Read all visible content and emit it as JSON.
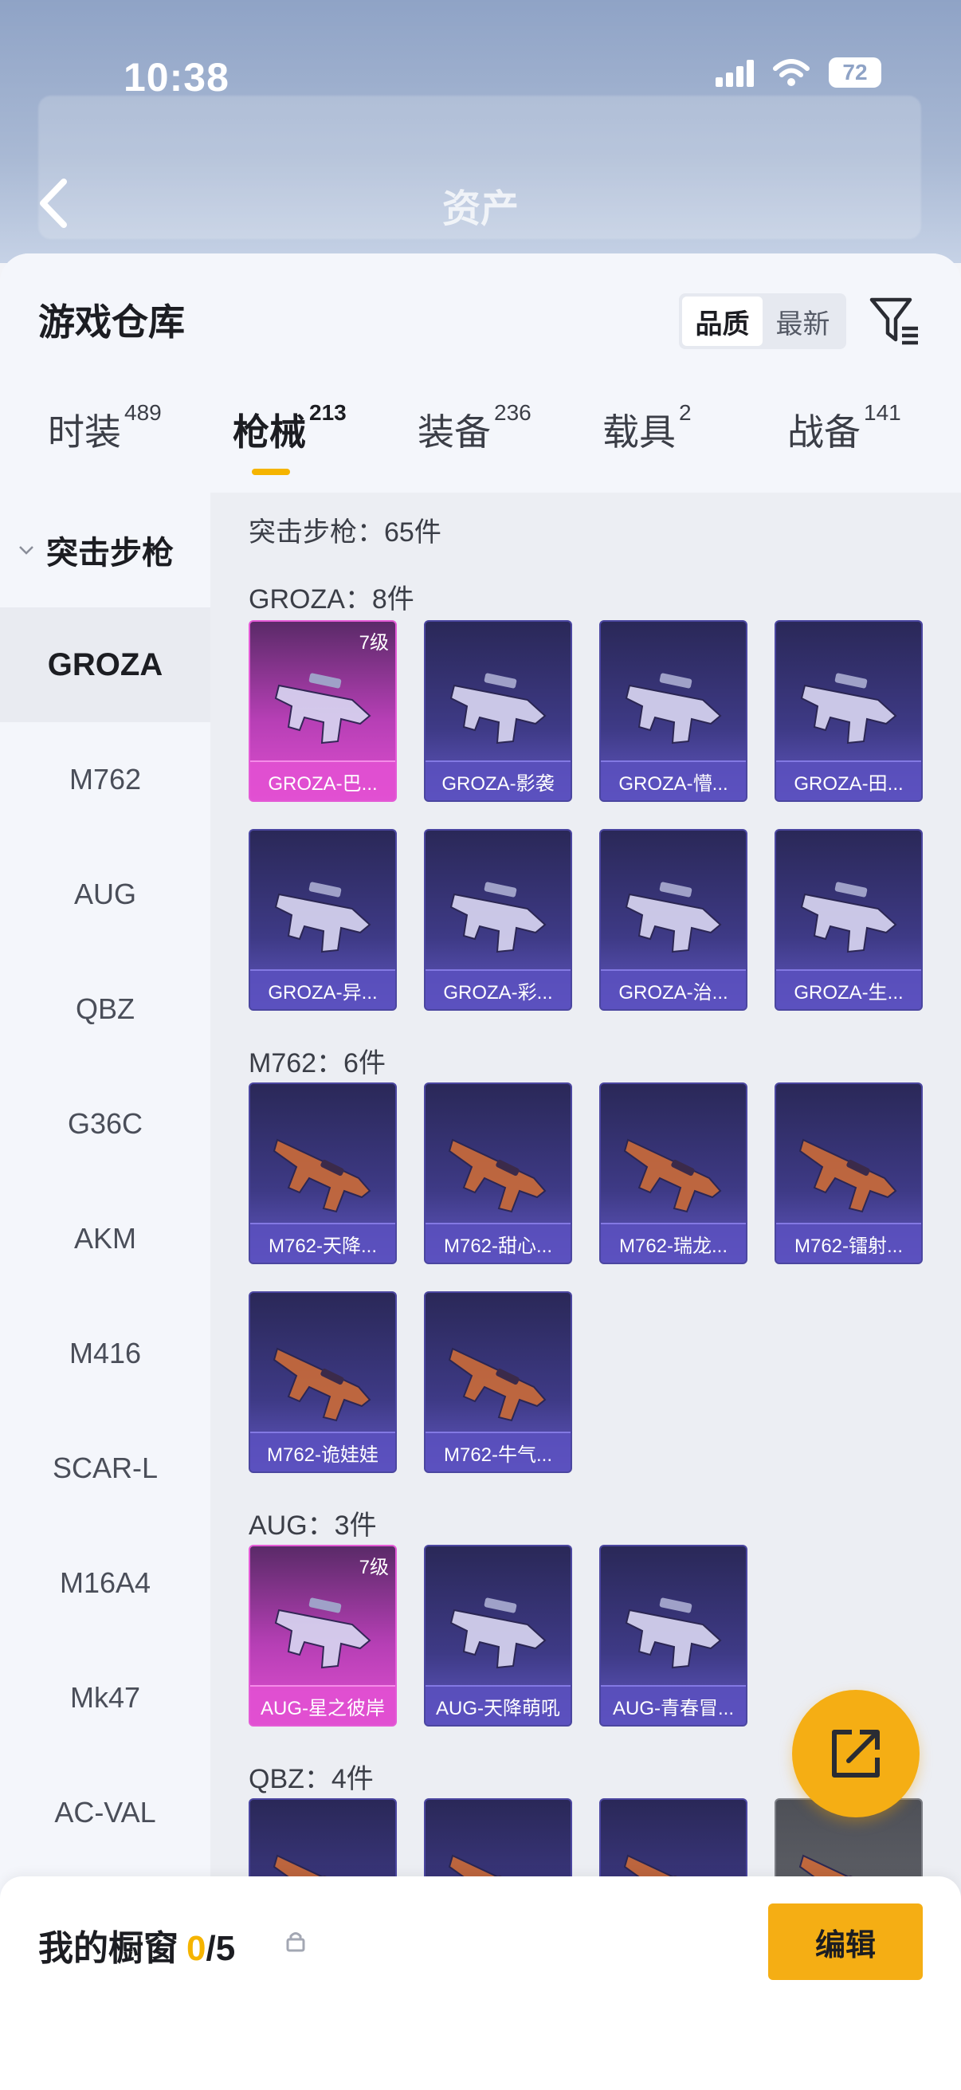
{
  "status_bar": {
    "time": "10:38",
    "battery": "72"
  },
  "header": {
    "title": "资产"
  },
  "warehouse": {
    "title": "游戏仓库",
    "sort_options": [
      "品质",
      "最新"
    ],
    "tabs": [
      {
        "label": "时装",
        "count": "489"
      },
      {
        "label": "枪械",
        "count": "213"
      },
      {
        "label": "装备",
        "count": "236"
      },
      {
        "label": "载具",
        "count": "2"
      },
      {
        "label": "战备",
        "count": "141"
      }
    ]
  },
  "rail": {
    "group": "突击步枪",
    "items": [
      "GROZA",
      "M762",
      "AUG",
      "QBZ",
      "G36C",
      "AKM",
      "M416",
      "SCAR-L",
      "M16A4",
      "Mk47",
      "AC-VAL"
    ]
  },
  "content": {
    "category_summary": "突击步枪：65件",
    "sections": [
      {
        "heading": "GROZA：8件",
        "items": [
          {
            "name": "GROZA-巴...",
            "level": "7级",
            "rarity": "pink"
          },
          {
            "name": "GROZA-影袭",
            "rarity": "purple"
          },
          {
            "name": "GROZA-懵...",
            "rarity": "purple"
          },
          {
            "name": "GROZA-田...",
            "rarity": "purple"
          },
          {
            "name": "GROZA-异...",
            "rarity": "purple"
          },
          {
            "name": "GROZA-彩...",
            "rarity": "purple"
          },
          {
            "name": "GROZA-治...",
            "rarity": "purple"
          },
          {
            "name": "GROZA-生...",
            "rarity": "purple"
          }
        ]
      },
      {
        "heading": "M762：6件",
        "items": [
          {
            "name": "M762-天降...",
            "rarity": "purple"
          },
          {
            "name": "M762-甜心...",
            "rarity": "purple"
          },
          {
            "name": "M762-瑞龙...",
            "rarity": "purple"
          },
          {
            "name": "M762-镭射...",
            "rarity": "purple"
          },
          {
            "name": "M762-诡娃娃",
            "rarity": "purple"
          },
          {
            "name": "M762-牛气...",
            "rarity": "purple"
          }
        ]
      },
      {
        "heading": "AUG：3件",
        "items": [
          {
            "name": "AUG-星之彼岸",
            "level": "7级",
            "rarity": "pink"
          },
          {
            "name": "AUG-天降萌吼",
            "rarity": "purple"
          },
          {
            "name": "AUG-青春冒...",
            "rarity": "purple"
          }
        ]
      },
      {
        "heading": "QBZ：4件",
        "items": []
      }
    ]
  },
  "showcase": {
    "title": "我的橱窗",
    "count": "0",
    "total": "/5",
    "edit_label": "编辑"
  },
  "colors": {
    "accent": "#f5ae14",
    "purple_card": "#3e3a86",
    "pink_card": "#e04fd0"
  }
}
